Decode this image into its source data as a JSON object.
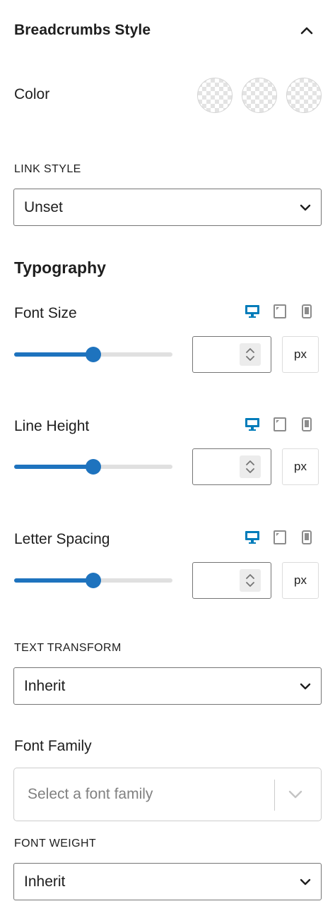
{
  "panel": {
    "title": "Breadcrumbs Style"
  },
  "color": {
    "label": "Color",
    "swatches": [
      "transparent",
      "transparent",
      "transparent"
    ]
  },
  "link_style": {
    "label": "LINK STYLE",
    "value": "Unset"
  },
  "typography": {
    "title": "Typography",
    "font_size": {
      "label": "Font Size",
      "unit": "px",
      "slider_fraction": 0.5,
      "value": ""
    },
    "line_height": {
      "label": "Line Height",
      "unit": "px",
      "slider_fraction": 0.5,
      "value": ""
    },
    "letter_spacing": {
      "label": "Letter Spacing",
      "unit": "px",
      "slider_fraction": 0.5,
      "value": ""
    }
  },
  "text_transform": {
    "label": "TEXT TRANSFORM",
    "value": "Inherit"
  },
  "font_family": {
    "label": "Font Family",
    "placeholder": "Select a font family"
  },
  "font_weight": {
    "label": "FONT WEIGHT",
    "value": "Inherit"
  },
  "colors": {
    "accent": "#1e73be",
    "active_device": "#007cba",
    "inactive_device": "#8c8c8c"
  },
  "icons": {
    "collapse": "chevron-up-icon",
    "select": "chevron-down-icon",
    "devices": [
      "desktop-icon",
      "tablet-icon",
      "mobile-icon"
    ],
    "spinner": "stepper-arrows-icon"
  }
}
